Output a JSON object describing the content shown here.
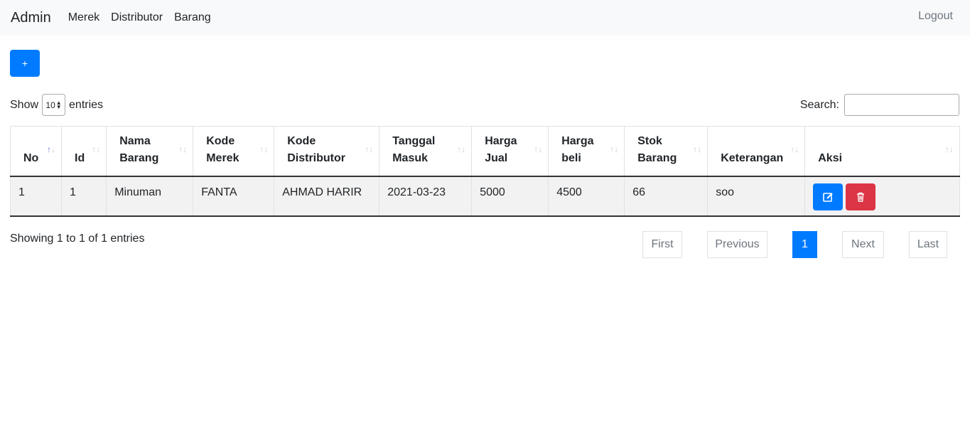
{
  "navbar": {
    "brand": "Admin",
    "links": [
      "Merek",
      "Distributor",
      "Barang"
    ],
    "logout": "Logout"
  },
  "add_button": "+",
  "length_menu": {
    "prefix": "Show",
    "value": "10",
    "suffix": "entries"
  },
  "search": {
    "label": "Search:",
    "value": ""
  },
  "table": {
    "headers": [
      [
        "No",
        ""
      ],
      [
        "Id",
        ""
      ],
      [
        "Nama",
        "Barang"
      ],
      [
        "Kode",
        "Merek"
      ],
      [
        "Kode",
        "Distributor"
      ],
      [
        "Tanggal",
        "Masuk"
      ],
      [
        "Harga",
        "Jual"
      ],
      [
        "Harga",
        "beli"
      ],
      [
        "Stok",
        "Barang"
      ],
      [
        "Keterangan",
        ""
      ],
      [
        "Aksi",
        ""
      ]
    ],
    "sorted_column": "No",
    "rows": [
      [
        "1",
        "1",
        "Minuman",
        "FANTA",
        "AHMAD HARIR",
        "2021-03-23",
        "5000",
        "4500",
        "66",
        "soo"
      ]
    ]
  },
  "info": "Showing 1 to 1 of 1 entries",
  "pagination": {
    "first": "First",
    "previous": "Previous",
    "current": "1",
    "next": "Next",
    "last": "Last"
  },
  "colors": {
    "primary": "#007bff",
    "danger": "#dc3545",
    "navbar_bg": "#f8f9fa"
  },
  "icons": {
    "edit": "edit-icon",
    "delete": "trash-icon"
  }
}
